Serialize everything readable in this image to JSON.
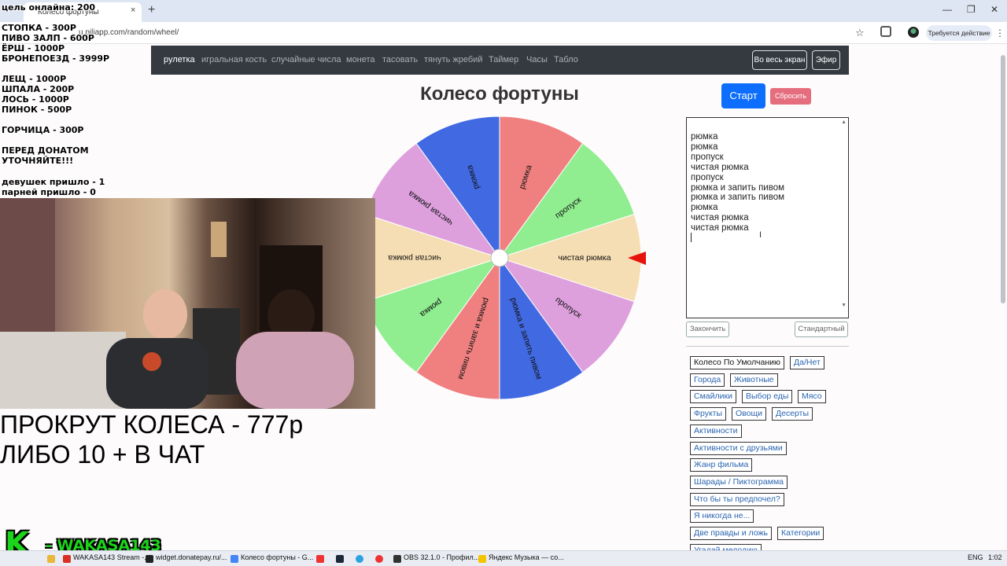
{
  "browser": {
    "tab_title": "Колесо фортуны",
    "tab_close": "×",
    "new_tab": "+",
    "url": "u.piliapp.com/random/wheel/",
    "action_required": "Требуется действие",
    "window_min": "—",
    "window_restore": "❐",
    "window_close": "✕",
    "star": "☆",
    "kebab": "⋮"
  },
  "site_nav": {
    "items": [
      "рулетка",
      "игральная кость",
      "случайные числа",
      "монета",
      "тасовать",
      "тянуть жребий",
      "Таймер",
      "Часы",
      "Табло"
    ],
    "fullscreen": "Во весь экран",
    "broadcast": "Эфир"
  },
  "page": {
    "title": "Колесо фортуны",
    "start": "Старт",
    "reset": "Сбросить",
    "finish": "Закончить",
    "standard": "Стандартный"
  },
  "entries": [
    "рюмка",
    "рюмка",
    "пропуск",
    "чистая рюмка",
    "пропуск",
    "рюмка и запить пивом",
    "рюмка и запить пивом",
    "рюмка",
    "чистая рюмка",
    "чистая рюмка"
  ],
  "wheel": {
    "segments": [
      {
        "label": "чистая рюмка",
        "color": "#f5deb3"
      },
      {
        "label": "пропуск",
        "color": "#dda0dd"
      },
      {
        "label": "рюмка и запить пивом",
        "color": "#4169e1"
      },
      {
        "label": "рюмка и запить пивом",
        "color": "#f08080"
      },
      {
        "label": "рюмка",
        "color": "#90ee90"
      },
      {
        "label": "чистая рюмка",
        "color": "#f5deb3"
      },
      {
        "label": "чистая рюмка",
        "color": "#dda0dd"
      },
      {
        "label": "рюмка",
        "color": "#4169e1"
      },
      {
        "label": "рюмка",
        "color": "#f08080"
      },
      {
        "label": "пропуск",
        "color": "#90ee90"
      }
    ],
    "pointer_color": "#e8120c"
  },
  "presets": [
    {
      "label": "Колесо По Умолчанию",
      "dark": true
    },
    {
      "label": "Да/Нет"
    },
    {
      "label": "Города"
    },
    {
      "label": "Животные"
    },
    {
      "label": "Смайлики"
    },
    {
      "label": "Выбор еды"
    },
    {
      "label": "Мясо"
    },
    {
      "label": "Фрукты"
    },
    {
      "label": "Овощи"
    },
    {
      "label": "Десерты"
    },
    {
      "label": "Активности"
    },
    {
      "label": "Активности с друзьями"
    },
    {
      "label": "Жанр фильма"
    },
    {
      "label": "Шарады / Пиктограмма"
    },
    {
      "label": "Что бы ты предпочел?"
    },
    {
      "label": "Я никогда не..."
    },
    {
      "label": "Две правды и ложь"
    },
    {
      "label": "Категории"
    },
    {
      "label": "Угадай мелодию"
    }
  ],
  "overlay": {
    "goal": "цель онлайна: 200",
    "prices": [
      "СТОПКА - 300Р",
      "ПИВО ЗАЛП - 600Р",
      "ЁРШ - 1000Р",
      "БРОНЕПОЕЗД - 3999Р"
    ],
    "prices2": [
      "ЛЕЩ - 1000Р",
      "ШПАЛА - 200Р",
      "ЛОСЬ - 1000Р",
      "ПИНОК - 500Р"
    ],
    "mustard": "ГОРЧИЦА - 300Р",
    "warn1": "ПЕРЕД  ДОНАТОМ",
    "warn2": "УТОЧНЯЙТЕ!!!",
    "girls": "девушек пришло - 1",
    "boys": "парней пришло - 0",
    "spin_line1": "ПРОКРУТ КОЛЕСА - 777р",
    "spin_line2": "ЛИБО 10 + В ЧАТ",
    "logo": "K",
    "channel": "- WAKASA143"
  },
  "taskbar": {
    "items": [
      {
        "label": "WAKASA143 Stream -...",
        "color": "#d93025"
      },
      {
        "label": "widget.donatepay.ru/...",
        "color": "#222"
      },
      {
        "label": "Колесо фортуны - G...",
        "color": "#4285f4"
      },
      {
        "label": "OBS 32.1.0 - Профил...",
        "color": "#333"
      },
      {
        "label": "Яндекс Музыка — со...",
        "color": "#f5c400"
      }
    ],
    "lang": "ENG",
    "time": "1:02"
  }
}
